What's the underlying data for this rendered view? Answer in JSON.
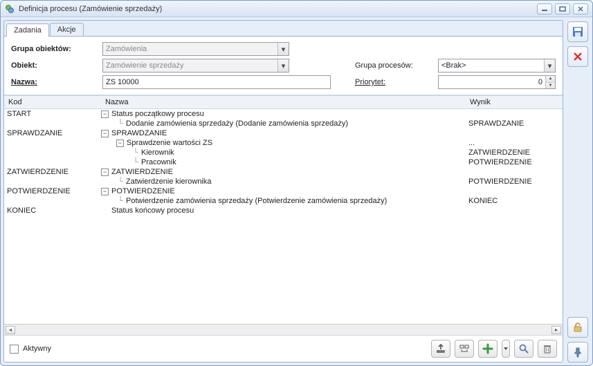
{
  "window": {
    "title": "Definicja procesu (Zamówienie sprzedaży)"
  },
  "tabs": {
    "zadania": "Zadania",
    "akcje": "Akcje"
  },
  "form": {
    "grupa_obiektow_label": "Grupa obiektów:",
    "grupa_obiektow_value": "Zamówienia",
    "obiekt_label": "Obiekt:",
    "obiekt_value": "Zamówienie sprzedaży",
    "nazwa_label": "Nazwa:",
    "nazwa_value": "ZS 10000",
    "grupa_procesow_label": "Grupa procesów:",
    "grupa_procesow_value": "<Brak>",
    "priorytet_label": "Priorytet:",
    "priorytet_value": "0"
  },
  "columns": {
    "kod": "Kod",
    "nazwa": "Nazwa",
    "wynik": "Wynik"
  },
  "rows": [
    {
      "kod": "START",
      "indent": 0,
      "expander": "-",
      "nazwa": "Status początkowy procesu",
      "wynik": ""
    },
    {
      "kod": "",
      "indent": 1,
      "elbow": true,
      "nazwa": "Dodanie zamówienia sprzedaży (Dodanie zamówienia sprzedaży)",
      "wynik": "SPRAWDZANIE"
    },
    {
      "kod": "SPRAWDZANIE",
      "indent": 0,
      "expander": "-",
      "nazwa": "SPRAWDZANIE",
      "wynik": ""
    },
    {
      "kod": "",
      "indent": 1,
      "expander": "-",
      "nazwa": "Sprawdzenie wartości ZS",
      "wynik": "..."
    },
    {
      "kod": "",
      "indent": 2,
      "elbow": true,
      "nazwa": "Kierownik",
      "wynik": "ZATWIERDZENIE"
    },
    {
      "kod": "",
      "indent": 2,
      "elbow": true,
      "nazwa": "Pracownik",
      "wynik": "POTWIERDZENIE"
    },
    {
      "kod": "ZATWIERDZENIE",
      "indent": 0,
      "expander": "-",
      "nazwa": "ZATWIERDZENIE",
      "wynik": ""
    },
    {
      "kod": "",
      "indent": 1,
      "elbow": true,
      "nazwa": "Zatwierdzenie kierownika",
      "wynik": "POTWIERDZENIE"
    },
    {
      "kod": "POTWIERDZENIE",
      "indent": 0,
      "expander": "-",
      "nazwa": "POTWIERDZENIE",
      "wynik": ""
    },
    {
      "kod": "",
      "indent": 1,
      "elbow": true,
      "nazwa": "Potwierdzenie zamówienia sprzedaży (Potwierdzenie zamówienia sprzedaży)",
      "wynik": "KONIEC"
    },
    {
      "kod": "KONIEC",
      "indent": 0,
      "nazwa": "Status końcowy procesu",
      "wynik": ""
    }
  ],
  "footer": {
    "aktywny": "Aktywny"
  }
}
